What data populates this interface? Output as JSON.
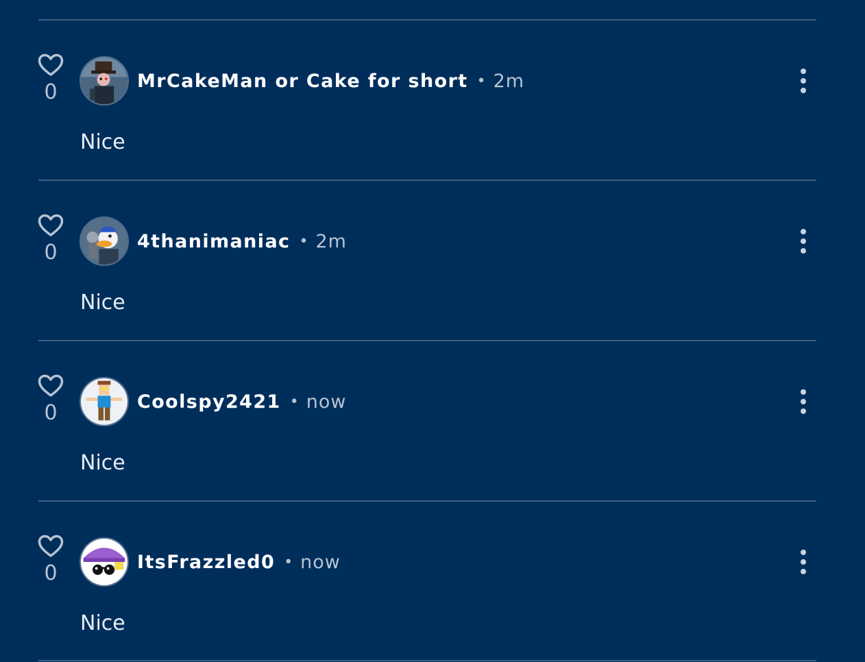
{
  "comments": [
    {
      "username": "MrCakeMan or Cake for short",
      "time": "2m",
      "likes": "0",
      "text": "Nice",
      "avatar": "avatar-top-hat-character"
    },
    {
      "username": "4thanimaniac",
      "time": "2m",
      "likes": "0",
      "text": "Nice",
      "avatar": "avatar-duck-character"
    },
    {
      "username": "Coolspy2421",
      "time": "now",
      "likes": "0",
      "text": "Nice",
      "avatar": "avatar-blue-shirt-character"
    },
    {
      "username": "ItsFrazzled0",
      "time": "now",
      "likes": "0",
      "text": "Nice",
      "avatar": "avatar-purple-cap-character"
    }
  ],
  "separator": "•",
  "icons": {
    "like": "heart-icon",
    "more": "more-vertical-icon"
  },
  "colors": {
    "background": "#002e5b",
    "divider": "#3f5f80",
    "username": "#ffffff",
    "muted": "#b8c4d2",
    "body_text": "#e8edf3"
  }
}
